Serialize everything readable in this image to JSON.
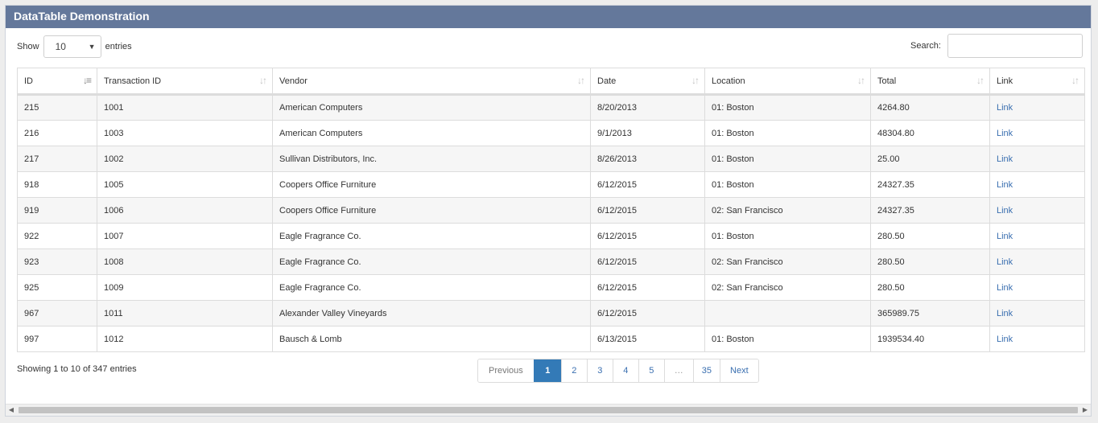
{
  "panel": {
    "title": "DataTable Demonstration"
  },
  "length": {
    "show_label": "Show",
    "value": "10",
    "entries_label": "entries"
  },
  "search": {
    "label": "Search:",
    "value": "",
    "placeholder": ""
  },
  "table": {
    "columns": [
      "ID",
      "Transaction ID",
      "Vendor",
      "Date",
      "Location",
      "Total",
      "Link"
    ],
    "sorted_column": "ID",
    "sort_direction": "ascending",
    "rows": [
      [
        "215",
        "1001",
        "American Computers",
        "8/20/2013",
        "01: Boston",
        "4264.80",
        "Link"
      ],
      [
        "216",
        "1003",
        "American Computers",
        "9/1/2013",
        "01: Boston",
        "48304.80",
        "Link"
      ],
      [
        "217",
        "1002",
        "Sullivan Distributors, Inc.",
        "8/26/2013",
        "01: Boston",
        "25.00",
        "Link"
      ],
      [
        "918",
        "1005",
        "Coopers Office Furniture",
        "6/12/2015",
        "01: Boston",
        "24327.35",
        "Link"
      ],
      [
        "919",
        "1006",
        "Coopers Office Furniture",
        "6/12/2015",
        "02: San Francisco",
        "24327.35",
        "Link"
      ],
      [
        "922",
        "1007",
        "Eagle Fragrance Co.",
        "6/12/2015",
        "01: Boston",
        "280.50",
        "Link"
      ],
      [
        "923",
        "1008",
        "Eagle Fragrance Co.",
        "6/12/2015",
        "02: San Francisco",
        "280.50",
        "Link"
      ],
      [
        "925",
        "1009",
        "Eagle Fragrance Co.",
        "6/12/2015",
        "02: San Francisco",
        "280.50",
        "Link"
      ],
      [
        "967",
        "1011",
        "Alexander Valley Vineyards",
        "6/12/2015",
        "",
        "365989.75",
        "Link"
      ],
      [
        "997",
        "1012",
        "Bausch & Lomb",
        "6/13/2015",
        "01: Boston",
        "1939534.40",
        "Link"
      ]
    ]
  },
  "info": "Showing 1 to 10 of 347 entries",
  "pagination": {
    "previous": "Previous",
    "pages": [
      "1",
      "2",
      "3",
      "4",
      "5"
    ],
    "active_page": "1",
    "ellipsis": "…",
    "last": "35",
    "next": "Next"
  },
  "colors": {
    "header_bg": "#64789b",
    "active_page_bg": "#337ab7",
    "link": "#3a6fb0"
  },
  "icons": {
    "sort_asc": "sort-asc-icon",
    "sort_both": "sort-both-icon",
    "caret": "caret-down-icon"
  }
}
